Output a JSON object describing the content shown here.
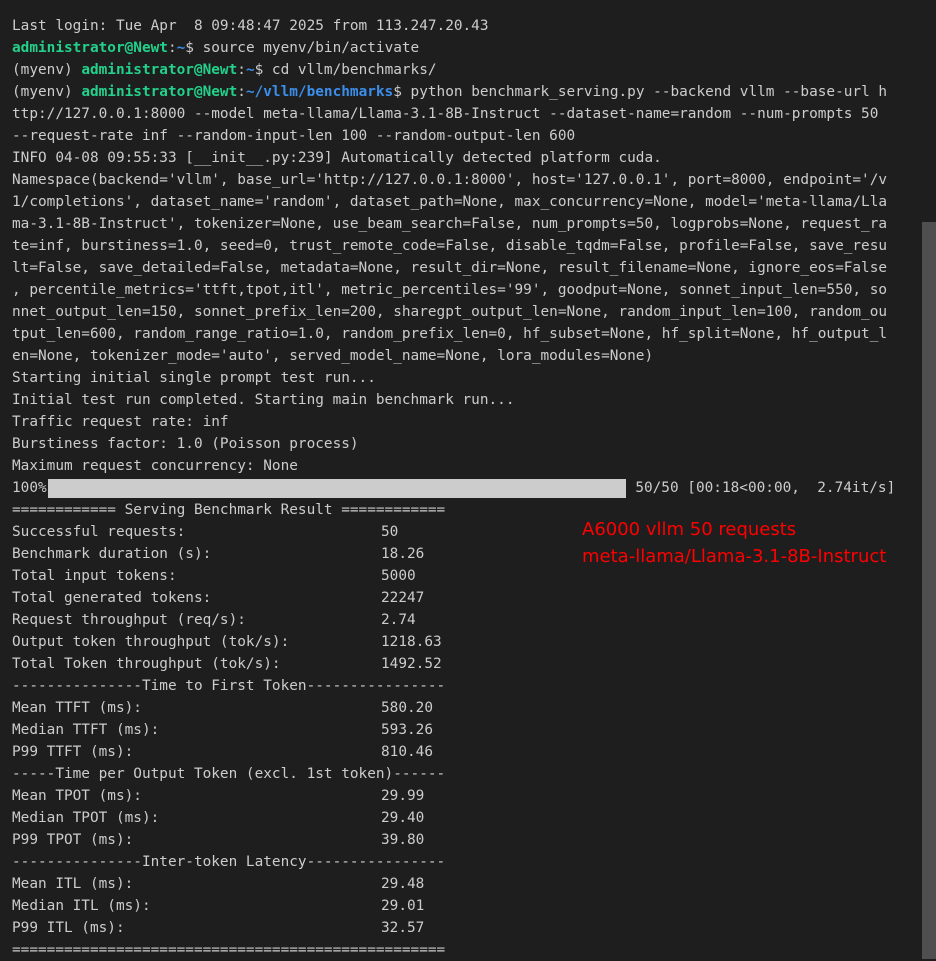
{
  "terminal": {
    "last_login": "Last login: Tue Apr  8 09:48:47 2025 from 113.247.20.43",
    "cmd1": {
      "prefix": "",
      "user": "administrator@Newt",
      "sep": ":",
      "path": "~",
      "command": "$ source myenv/bin/activate"
    },
    "cmd2": {
      "prefix": "(myenv) ",
      "user": "administrator@Newt",
      "sep": ":",
      "path": "~",
      "command": "$ cd vllm/benchmarks/"
    },
    "cmd3": {
      "prefix": "(myenv) ",
      "user": "administrator@Newt",
      "sep": ":",
      "path": "~/vllm/benchmarks",
      "command": "$ python benchmark_serving.py --backend vllm --base-url h"
    },
    "cmd3_wrap": [
      "ttp://127.0.0.1:8000 --model meta-llama/Llama-3.1-8B-Instruct --dataset-name=random --num-prompts 50",
      "--request-rate inf --random-input-len 100 --random-output-len 600"
    ],
    "info_line": "INFO 04-08 09:55:33 [__init__.py:239] Automatically detected platform cuda.",
    "namespace_lines": [
      "Namespace(backend='vllm', base_url='http://127.0.0.1:8000', host='127.0.0.1', port=8000, endpoint='/v",
      "1/completions', dataset_name='random', dataset_path=None, max_concurrency=None, model='meta-llama/Lla",
      "ma-3.1-8B-Instruct', tokenizer=None, use_beam_search=False, num_prompts=50, logprobs=None, request_ra",
      "te=inf, burstiness=1.0, seed=0, trust_remote_code=False, disable_tqdm=False, profile=False, save_resu",
      "lt=False, save_detailed=False, metadata=None, result_dir=None, result_filename=None, ignore_eos=False",
      ", percentile_metrics='ttft,tpot,itl', metric_percentiles='99', goodput=None, sonnet_input_len=550, so",
      "nnet_output_len=150, sonnet_prefix_len=200, sharegpt_output_len=None, random_input_len=100, random_ou",
      "tput_len=600, random_range_ratio=1.0, random_prefix_len=0, hf_subset=None, hf_split=None, hf_output_l",
      "en=None, tokenizer_mode='auto', served_model_name=None, lora_modules=None)"
    ],
    "status_lines": [
      "Starting initial single prompt test run...",
      "Initial test run completed. Starting main benchmark run...",
      "Traffic request rate: inf",
      "Burstiness factor: 1.0 (Poisson process)",
      "Maximum request concurrency: None"
    ],
    "progress": {
      "percent_label": "100%",
      "fraction": 1.0,
      "stats": " 50/50 [00:18<00:00,  2.74it/s]"
    },
    "result_header": "============ Serving Benchmark Result ============",
    "summary_rows": [
      {
        "label": "Successful requests:",
        "value": "50"
      },
      {
        "label": "Benchmark duration (s):",
        "value": "18.26"
      },
      {
        "label": "Total input tokens:",
        "value": "5000"
      },
      {
        "label": "Total generated tokens:",
        "value": "22247"
      },
      {
        "label": "Request throughput (req/s):",
        "value": "2.74"
      },
      {
        "label": "Output token throughput (tok/s):",
        "value": "1218.63"
      },
      {
        "label": "Total Token throughput (tok/s):",
        "value": "1492.52"
      }
    ],
    "ttft_header": "---------------Time to First Token----------------",
    "ttft_rows": [
      {
        "label": "Mean TTFT (ms):",
        "value": "580.20"
      },
      {
        "label": "Median TTFT (ms):",
        "value": "593.26"
      },
      {
        "label": "P99 TTFT (ms):",
        "value": "810.46"
      }
    ],
    "tpot_header": "-----Time per Output Token (excl. 1st token)------",
    "tpot_rows": [
      {
        "label": "Mean TPOT (ms):",
        "value": "29.99"
      },
      {
        "label": "Median TPOT (ms):",
        "value": "29.40"
      },
      {
        "label": "P99 TPOT (ms):",
        "value": "39.80"
      }
    ],
    "itl_header": "---------------Inter-token Latency----------------",
    "itl_rows": [
      {
        "label": "Mean ITL (ms):",
        "value": "29.48"
      },
      {
        "label": "Median ITL (ms):",
        "value": "29.01"
      },
      {
        "label": "P99 ITL (ms):",
        "value": "32.57"
      }
    ],
    "footer_line": "=================================================="
  },
  "annotation": {
    "line1": "A6000 vllm 50 requests",
    "line2": "meta-llama/Llama-3.1-8B-Instruct",
    "color": "#ff0000"
  },
  "colors": {
    "background": "#1e1e1e",
    "text": "#cccccc",
    "user": "#23d18b",
    "path": "#3b8eea"
  }
}
